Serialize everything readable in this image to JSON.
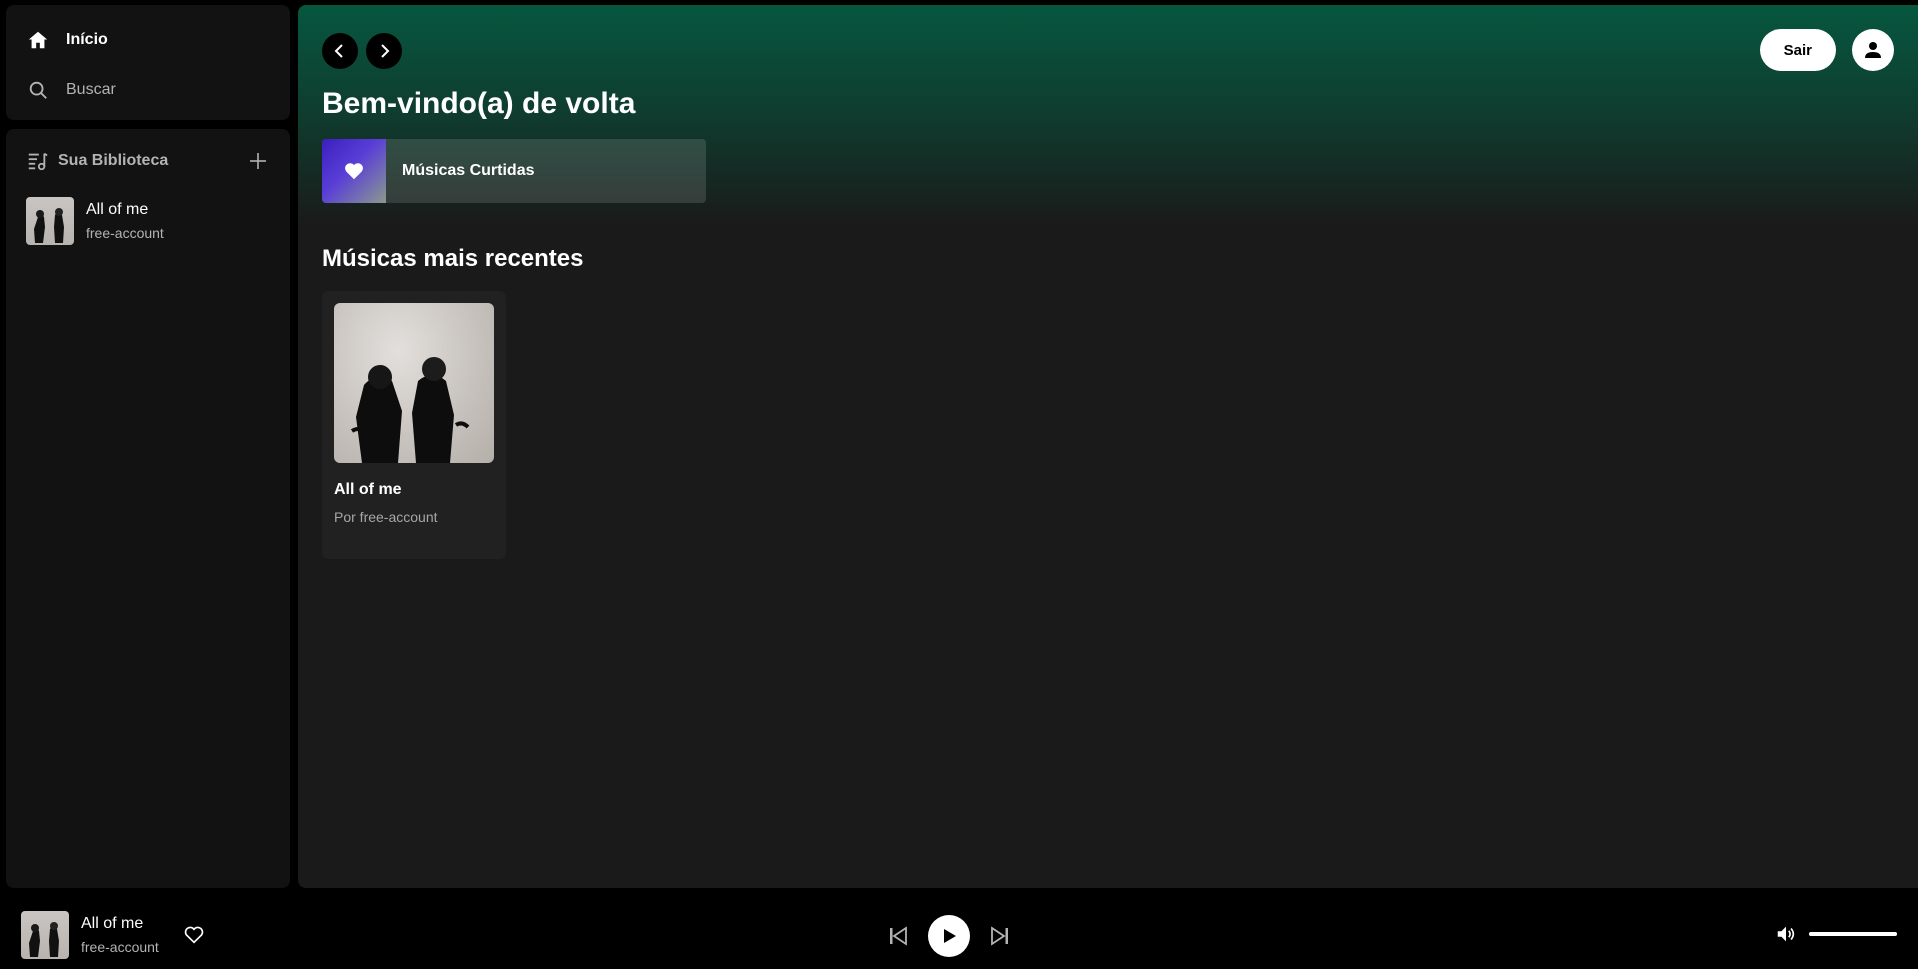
{
  "sidebar": {
    "nav": [
      {
        "label": "Início",
        "icon": "home-icon",
        "active": true
      },
      {
        "label": "Buscar",
        "icon": "search-icon",
        "active": false
      }
    ],
    "library": {
      "title": "Sua Biblioteca",
      "items": [
        {
          "title": "All of me",
          "subtitle": "free-account"
        }
      ]
    }
  },
  "main": {
    "welcome": "Bem-vindo(a) de volta",
    "logout_label": "Sair",
    "liked_label": "Músicas Curtidas",
    "recent_title": "Músicas mais recentes",
    "recent": [
      {
        "title": "All of me",
        "subtitle": "Por free-account"
      }
    ]
  },
  "player": {
    "title": "All of me",
    "artist": "free-account",
    "volume": 1.0
  },
  "colors": {
    "accent_green": "#06573f",
    "liked_gradient_start": "#3a1fbf"
  }
}
